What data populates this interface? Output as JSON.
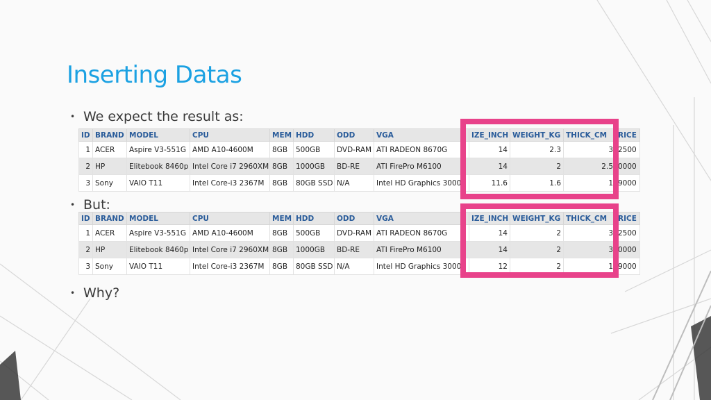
{
  "slide": {
    "title": "Inserting Datas",
    "bullets": [
      "We expect the result as:",
      "But:",
      "Why?"
    ]
  },
  "colors": {
    "title": "#1ba1e2",
    "highlight_border": "#e8428a",
    "table_header_text": "#2a5c9a"
  },
  "columns": [
    "ID",
    "BRAND",
    "MODEL",
    "CPU",
    "MEM",
    "HDD",
    "ODD",
    "VGA",
    "IZE_INCH",
    "WEIGHT_KG",
    "THICK_CM",
    "RICE"
  ],
  "expected_table": {
    "rows": [
      [
        "1",
        "ACER",
        "Aspire V3-551G",
        "AMD A10-4600M",
        "8GB",
        "500GB",
        "DVD-RAM",
        "ATI RADEON 8670G",
        "14",
        "2.3",
        "3",
        "2500"
      ],
      [
        "2",
        "HP",
        "Elitebook 8460p",
        "Intel Core i7 2960XM",
        "8GB",
        "1000GB",
        "BD-RE",
        "ATI FirePro M6100",
        "14",
        "2",
        "2.5",
        "0000"
      ],
      [
        "3",
        "Sony",
        "VAIO T11",
        "Intel Core-i3 2367M",
        "8GB",
        "80GB SSD",
        "N/A",
        "Intel HD Graphics 3000",
        "11.6",
        "1.6",
        "1",
        "9000"
      ]
    ]
  },
  "actual_table": {
    "rows": [
      [
        "1",
        "ACER",
        "Aspire V3-551G",
        "AMD A10-4600M",
        "8GB",
        "500GB",
        "DVD-RAM",
        "ATI RADEON 8670G",
        "14",
        "2",
        "3",
        "2500"
      ],
      [
        "2",
        "HP",
        "Elitebook 8460p",
        "Intel Core i7 2960XM",
        "8GB",
        "1000GB",
        "BD-RE",
        "ATI FirePro M6100",
        "14",
        "2",
        "3",
        "0000"
      ],
      [
        "3",
        "Sony",
        "VAIO T11",
        "Intel Core-i3 2367M",
        "8GB",
        "80GB SSD",
        "N/A",
        "Intel HD Graphics 3000",
        "12",
        "2",
        "1",
        "9000"
      ]
    ]
  }
}
